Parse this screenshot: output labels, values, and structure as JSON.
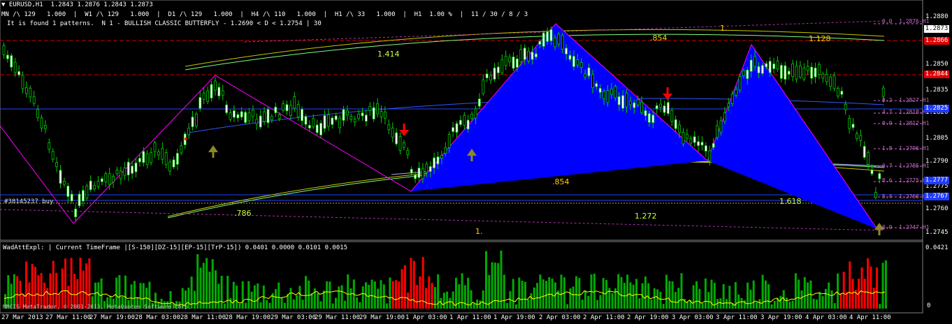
{
  "header": {
    "symbol_line": "EURUSD,H1  1.2843 1.2876 1.2843 1.2873",
    "timeframes_line": "MN /\\ 129   1.000  |  W1 /\\ 129   1.000  |  D1 /\\ 129   1.000  |  H4 /\\ 110   1.000  |  H1 /\\ 33   1.000  |  H1  1.00 %  |  11 / 30 / 8 / 3",
    "pattern_line": "It is found 1 patterns.  N 1 - BULLISH CLASSIC BUTTERFLY - 1.2690 < D < 1.2754 | 30"
  },
  "order_label": "#38145237 buy",
  "fib_labels": {
    "r1414": "1.414",
    "r854_top": ".854",
    "r1_top": "1.",
    "r1128": "1.128",
    "r854_mid": ".854",
    "r786": ".786",
    "r1272": "1.272",
    "r1618": "1.618",
    "r1_bottom": "1."
  },
  "level_labels": [
    "0.0  1.2876-H1",
    "8.2  1.2827-H1",
    "4.7  1.2818-H1",
    "0.0  1.2812-H1",
    "1.8  1.2796-H1",
    "0.7  1.2785-H1",
    "8.6  1.2775-H1",
    "5.4  1.2766-H1",
    "0.0  1.2747-H1"
  ],
  "price_axis": [
    "1.2880",
    "1.2850",
    "1.2835",
    "1.2820",
    "1.2805",
    "1.2790",
    "1.2775",
    "1.2760",
    "1.2745"
  ],
  "price_boxes": {
    "current": "1.2873",
    "red1": "1.2866",
    "red2": "1.2844",
    "blue1": "1.2825",
    "blue2": "1.2777",
    "blue3": "1.2767"
  },
  "indicator": {
    "title": "WadAttExpl: | Current TimeFrame |[S-150][DZ-15][EP-15][TrP-15]) 0.0401 0.0000 0.0101 0.0015",
    "axis_top": "0.0421",
    "axis_zero": "0",
    "copyright": "MMCIS MetaTrader, © 2001-2013, MetaQuotes Software Corp."
  },
  "time_axis": [
    "27 Mar 2013",
    "27 Mar 11:00",
    "27 Mar 19:00",
    "28 Mar 03:00",
    "28 Mar 11:00",
    "28 Mar 19:00",
    "29 Mar 03:00",
    "29 Mar 11:00",
    "29 Mar 19:00",
    "1 Apr 03:00",
    "1 Apr 11:00",
    "1 Apr 19:00",
    "2 Apr 03:00",
    "2 Apr 11:00",
    "2 Apr 19:00",
    "3 Apr 03:00",
    "3 Apr 11:00",
    "3 Apr 19:00",
    "4 Apr 03:00",
    "4 Apr 11:00"
  ],
  "colors": {
    "background": "#000000",
    "bull_candle": "#ffffff",
    "bear_candle": "#00cc00",
    "pattern_fill": "#0000ff",
    "zigzag": "#ff00ff",
    "histogram_up": "#00aa00",
    "histogram_down": "#ff0000",
    "signal_line": "#ffff00"
  }
}
